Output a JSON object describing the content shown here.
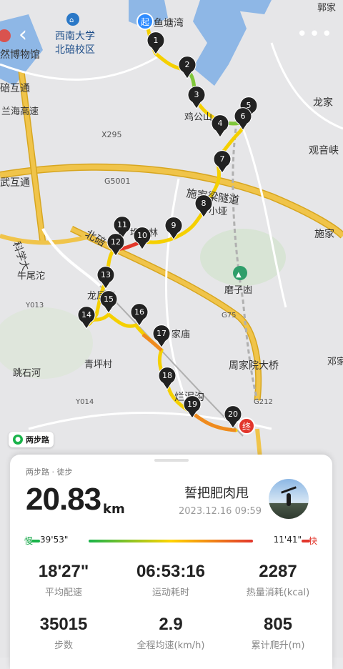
{
  "map": {
    "start_label": "起",
    "end_label": "终",
    "markers": [
      "1",
      "2",
      "3",
      "4",
      "5",
      "6",
      "7",
      "8",
      "9",
      "10",
      "11",
      "12",
      "13",
      "14",
      "15",
      "16",
      "17",
      "18",
      "19",
      "20"
    ],
    "places": {
      "p1": "鱼塘湾",
      "p2": "西南大学",
      "p3": "北碚校区",
      "p4": "然博物馆",
      "p5": "碚互通",
      "p6": "兰海高速",
      "p7": "X295",
      "p8": "G5001",
      "p9": "武互通",
      "p10": "施家梁隧道",
      "p11": "鸡公山",
      "p12": "龙家",
      "p13": "观音峡",
      "p14": "施家",
      "p15": "北碚",
      "p16": "科学大",
      "p17": "牛尾沱",
      "p18": "Y013",
      "p19": "磨子凼",
      "p20": "G75",
      "p21": "家庙",
      "p22": "青坪村",
      "p23": "周家院大桥",
      "p24": "跳石河",
      "p25": "Y014",
      "p26": "烂泥沟",
      "p27": "G212",
      "p28": "邓家",
      "p29": "郭家",
      "p30": "小垭",
      "p31": "龙凤湾",
      "p32": "堆竹林"
    }
  },
  "top": {
    "back_icon": "‹",
    "more_icon": "•••"
  },
  "logo": {
    "label": "两步路"
  },
  "card": {
    "subtitle": "两步路 · 徒步",
    "distance": "20.83",
    "distance_unit": "km",
    "user_name": "誓把肥肉甩",
    "date": "2023.12.16 09:59",
    "pace": {
      "slow_label": "慢",
      "slow_value": "39'53\"",
      "fast_value": "11'41\"",
      "fast_label": "快"
    },
    "stats": [
      {
        "value": "18'27\"",
        "label": "平均配速"
      },
      {
        "value": "06:53:16",
        "label": "运动耗时"
      },
      {
        "value": "2287",
        "label": "热量消耗(kcal)"
      },
      {
        "value": "35015",
        "label": "步数"
      },
      {
        "value": "2.9",
        "label": "全程均速(km/h)"
      },
      {
        "value": "805",
        "label": "累计爬升(m)"
      }
    ]
  }
}
